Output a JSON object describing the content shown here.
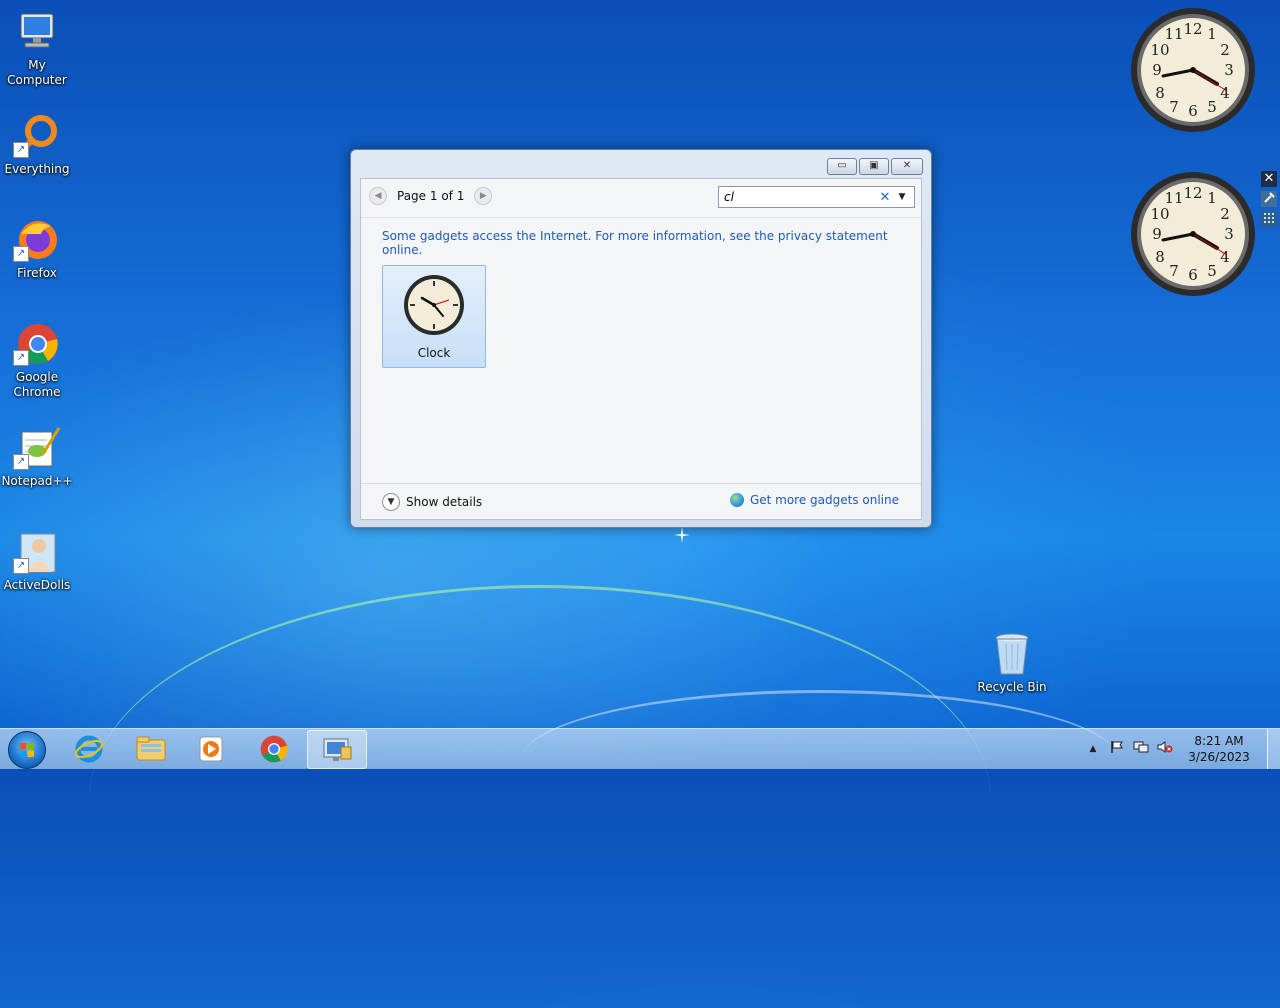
{
  "desktop": {
    "icons": [
      {
        "label": "My Computer"
      },
      {
        "label": "Everything"
      },
      {
        "label": "Firefox"
      },
      {
        "label": "Google Chrome"
      },
      {
        "label": "Notepad++"
      },
      {
        "label": "ActiveDolls"
      },
      {
        "label": "Recycle Bin"
      }
    ]
  },
  "gadgets_window": {
    "controls": {
      "minimize": "▭",
      "restore": "▣",
      "close": "✕"
    },
    "pager": {
      "prev": "◀",
      "label": "Page 1 of 1",
      "next": "▶"
    },
    "search": {
      "value": "cl",
      "clear": "✕",
      "dropdown": "▼"
    },
    "notice": "Some gadgets access the Internet.  For more information, see the privacy statement online.",
    "gadgets": [
      {
        "label": "Clock",
        "icon": "clock-icon"
      }
    ],
    "show_details": "Show details",
    "more_gadgets": "Get more gadgets online"
  },
  "gadget_controls": {
    "close": "✕"
  },
  "taskbar": {
    "pinned": [
      {
        "name": "internet-explorer-icon"
      },
      {
        "name": "file-explorer-icon"
      },
      {
        "name": "media-player-icon"
      },
      {
        "name": "chrome-icon"
      },
      {
        "name": "gadgets-window-icon"
      }
    ],
    "tray": {
      "chevron": "▲",
      "time": "8:21 AM",
      "date": "3/26/2023"
    }
  }
}
